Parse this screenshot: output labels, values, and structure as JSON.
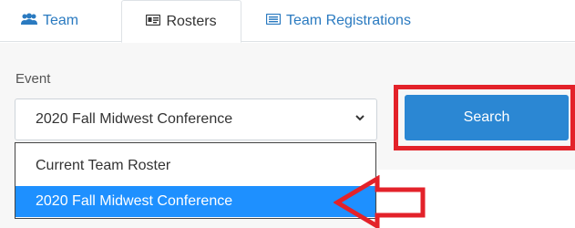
{
  "tabs": [
    {
      "label": "Team",
      "icon": "users-icon"
    },
    {
      "label": "Rosters",
      "icon": "id-card-icon"
    },
    {
      "label": "Team Registrations",
      "icon": "list-icon"
    }
  ],
  "event": {
    "label": "Event",
    "selected": "2020 Fall Midwest Conference",
    "options": [
      "Current Team Roster",
      "2020 Fall Midwest Conference"
    ]
  },
  "search_button": {
    "label": "Search"
  },
  "colors": {
    "accent": "#2b87d3",
    "highlight": "#1e90ff",
    "annotation_red": "#e3222a"
  }
}
